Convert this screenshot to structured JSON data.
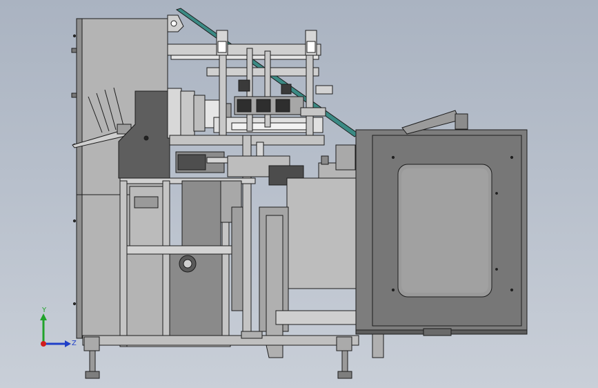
{
  "viewport": {
    "background_top": "#aab3c1",
    "background_bottom": "#c9cfd8"
  },
  "triad": {
    "y_label": "Y",
    "z_label": "Z",
    "y_color": "#21a32b",
    "z_color": "#1f3fc8",
    "origin_color": "#d21d1d"
  },
  "colors": {
    "metal_light": "#b9b9b9",
    "metal_mid": "#9e9e9e",
    "metal_dark": "#5c5c5c",
    "outline": "#1c1c1c",
    "belt": "#3b8a84"
  }
}
